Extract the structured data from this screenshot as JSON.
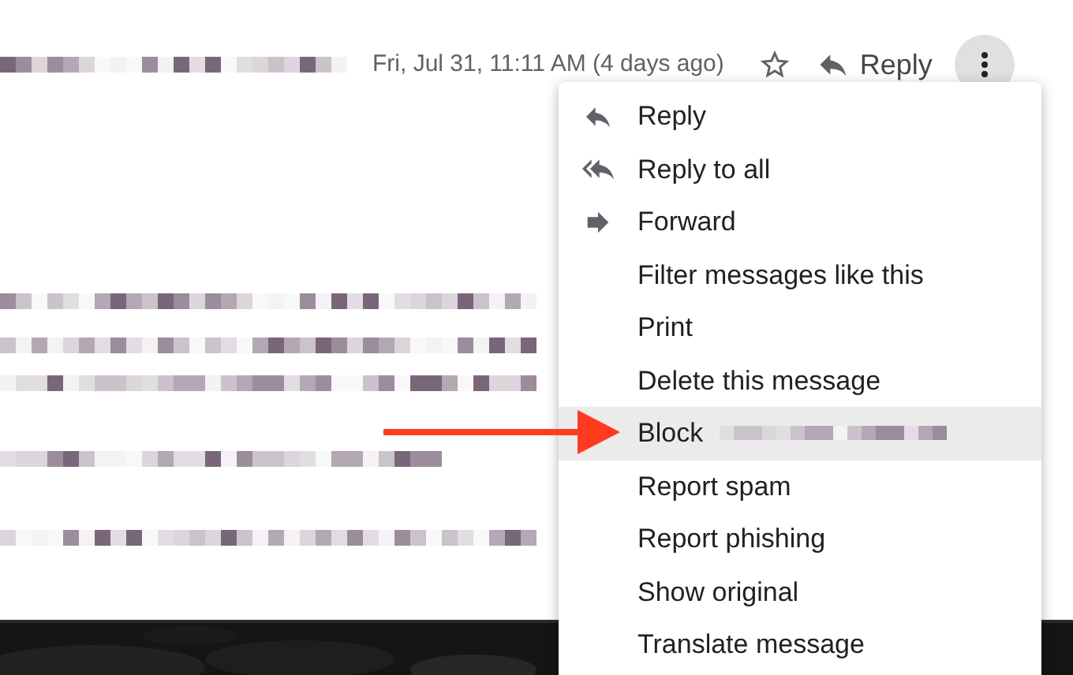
{
  "header": {
    "sender_redacted": true,
    "date": "Fri, Jul 31, 11:11 AM (4 days ago)",
    "reply_label": "Reply",
    "more_open": true
  },
  "menu": {
    "items": [
      {
        "label": "Reply",
        "kind": "reply",
        "highlighted": false,
        "redacted": false
      },
      {
        "label": "Reply to all",
        "kind": "reply_all",
        "highlighted": false,
        "redacted": false
      },
      {
        "label": "Forward",
        "kind": "forward",
        "highlighted": false,
        "redacted": false
      },
      {
        "label": "Filter messages like this",
        "kind": "plain",
        "highlighted": false,
        "redacted": false
      },
      {
        "label": "Print",
        "kind": "plain",
        "highlighted": false,
        "redacted": false
      },
      {
        "label": "Delete this message",
        "kind": "plain",
        "highlighted": false,
        "redacted": false
      },
      {
        "label": "Block",
        "kind": "plain",
        "highlighted": true,
        "redacted": true
      },
      {
        "label": "Report spam",
        "kind": "plain",
        "highlighted": false,
        "redacted": false
      },
      {
        "label": "Report phishing",
        "kind": "plain",
        "highlighted": false,
        "redacted": false
      },
      {
        "label": "Show original",
        "kind": "plain",
        "highlighted": false,
        "redacted": false
      },
      {
        "label": "Translate message",
        "kind": "plain",
        "highlighted": false,
        "redacted": false
      }
    ]
  }
}
